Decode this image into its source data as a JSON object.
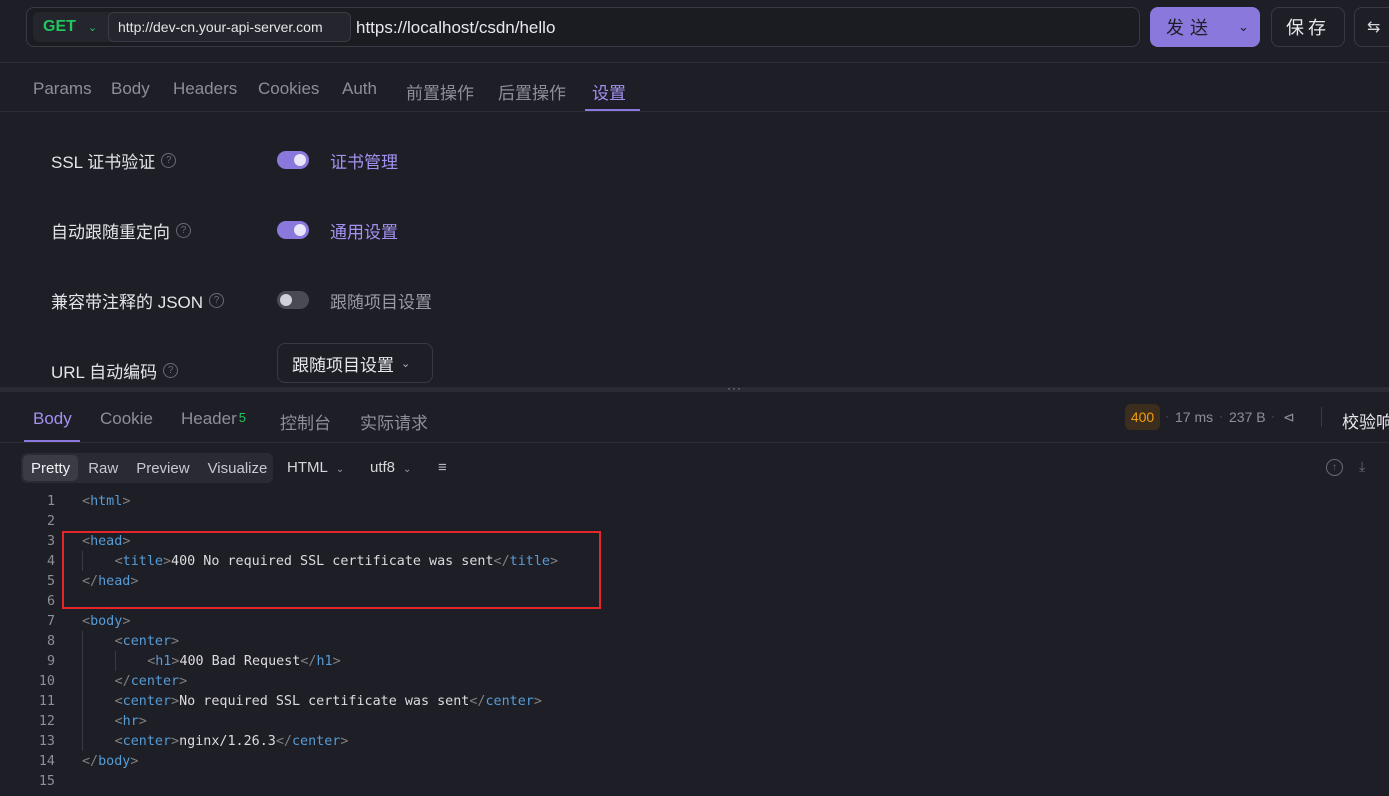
{
  "request": {
    "method": "GET",
    "env_base_url": "http://dev-cn.your-api-server.com",
    "url": "https://localhost/csdn/hello",
    "send_label": "发送",
    "save_label": "保存"
  },
  "request_tabs": [
    "Params",
    "Body",
    "Headers",
    "Cookies",
    "Auth",
    "前置操作",
    "后置操作",
    "设置"
  ],
  "active_request_tab": "设置",
  "settings": {
    "ssl_label": "SSL 证书验证",
    "ssl_on": true,
    "ssl_link": "证书管理",
    "redirect_label": "自动跟随重定向",
    "redirect_on": true,
    "redirect_link": "通用设置",
    "json_label": "兼容带注释的 JSON",
    "json_on": false,
    "json_link": "跟随项目设置",
    "url_encode_label": "URL 自动编码",
    "url_encode_value": "跟随项目设置"
  },
  "response_tabs": {
    "body": "Body",
    "cookie": "Cookie",
    "header": "Header",
    "header_count": "5",
    "console": "控制台",
    "actual_request": "实际请求"
  },
  "response_meta": {
    "status": "400",
    "time": "17 ms",
    "size": "237 B",
    "verify_label": "校验响"
  },
  "view_modes": [
    "Pretty",
    "Raw",
    "Preview",
    "Visualize"
  ],
  "active_view_mode": "Pretty",
  "format": "HTML",
  "encoding": "utf8",
  "code_lines": [
    {
      "num": "1",
      "indent": 0,
      "segments": [
        {
          "type": "br",
          "text": "<"
        },
        {
          "type": "tag",
          "text": "html"
        },
        {
          "type": "br",
          "text": ">"
        }
      ]
    },
    {
      "num": "2",
      "indent": 0,
      "segments": []
    },
    {
      "num": "3",
      "indent": 0,
      "segments": [
        {
          "type": "br",
          "text": "<"
        },
        {
          "type": "tag",
          "text": "head"
        },
        {
          "type": "br",
          "text": ">"
        }
      ]
    },
    {
      "num": "4",
      "indent": 1,
      "segments": [
        {
          "type": "br",
          "text": "<"
        },
        {
          "type": "tag",
          "text": "title"
        },
        {
          "type": "br",
          "text": ">"
        },
        {
          "type": "txt",
          "text": "400 No required SSL certificate was sent"
        },
        {
          "type": "br",
          "text": "</"
        },
        {
          "type": "tag",
          "text": "title"
        },
        {
          "type": "br",
          "text": ">"
        }
      ]
    },
    {
      "num": "5",
      "indent": 0,
      "segments": [
        {
          "type": "br",
          "text": "</"
        },
        {
          "type": "tag",
          "text": "head"
        },
        {
          "type": "br",
          "text": ">"
        }
      ]
    },
    {
      "num": "6",
      "indent": 0,
      "segments": []
    },
    {
      "num": "7",
      "indent": 0,
      "segments": [
        {
          "type": "br",
          "text": "<"
        },
        {
          "type": "tag",
          "text": "body"
        },
        {
          "type": "br",
          "text": ">"
        }
      ]
    },
    {
      "num": "8",
      "indent": 1,
      "segments": [
        {
          "type": "br",
          "text": "<"
        },
        {
          "type": "tag",
          "text": "center"
        },
        {
          "type": "br",
          "text": ">"
        }
      ]
    },
    {
      "num": "9",
      "indent": 2,
      "segments": [
        {
          "type": "br",
          "text": "<"
        },
        {
          "type": "tag",
          "text": "h1"
        },
        {
          "type": "br",
          "text": ">"
        },
        {
          "type": "txt",
          "text": "400 Bad Request"
        },
        {
          "type": "br",
          "text": "</"
        },
        {
          "type": "tag",
          "text": "h1"
        },
        {
          "type": "br",
          "text": ">"
        }
      ]
    },
    {
      "num": "10",
      "indent": 1,
      "segments": [
        {
          "type": "br",
          "text": "</"
        },
        {
          "type": "tag",
          "text": "center"
        },
        {
          "type": "br",
          "text": ">"
        }
      ]
    },
    {
      "num": "11",
      "indent": 1,
      "segments": [
        {
          "type": "br",
          "text": "<"
        },
        {
          "type": "tag",
          "text": "center"
        },
        {
          "type": "br",
          "text": ">"
        },
        {
          "type": "txt",
          "text": "No required SSL certificate was sent"
        },
        {
          "type": "br",
          "text": "</"
        },
        {
          "type": "tag",
          "text": "center"
        },
        {
          "type": "br",
          "text": ">"
        }
      ]
    },
    {
      "num": "12",
      "indent": 1,
      "segments": [
        {
          "type": "br",
          "text": "<"
        },
        {
          "type": "tag",
          "text": "hr"
        },
        {
          "type": "br",
          "text": ">"
        }
      ]
    },
    {
      "num": "13",
      "indent": 1,
      "segments": [
        {
          "type": "br",
          "text": "<"
        },
        {
          "type": "tag",
          "text": "center"
        },
        {
          "type": "br",
          "text": ">"
        },
        {
          "type": "txt",
          "text": "nginx/1.26.3"
        },
        {
          "type": "br",
          "text": "</"
        },
        {
          "type": "tag",
          "text": "center"
        },
        {
          "type": "br",
          "text": ">"
        }
      ]
    },
    {
      "num": "14",
      "indent": 0,
      "segments": [
        {
          "type": "br",
          "text": "</"
        },
        {
          "type": "tag",
          "text": "body"
        },
        {
          "type": "br",
          "text": ">"
        }
      ]
    },
    {
      "num": "15",
      "indent": 0,
      "segments": []
    }
  ]
}
